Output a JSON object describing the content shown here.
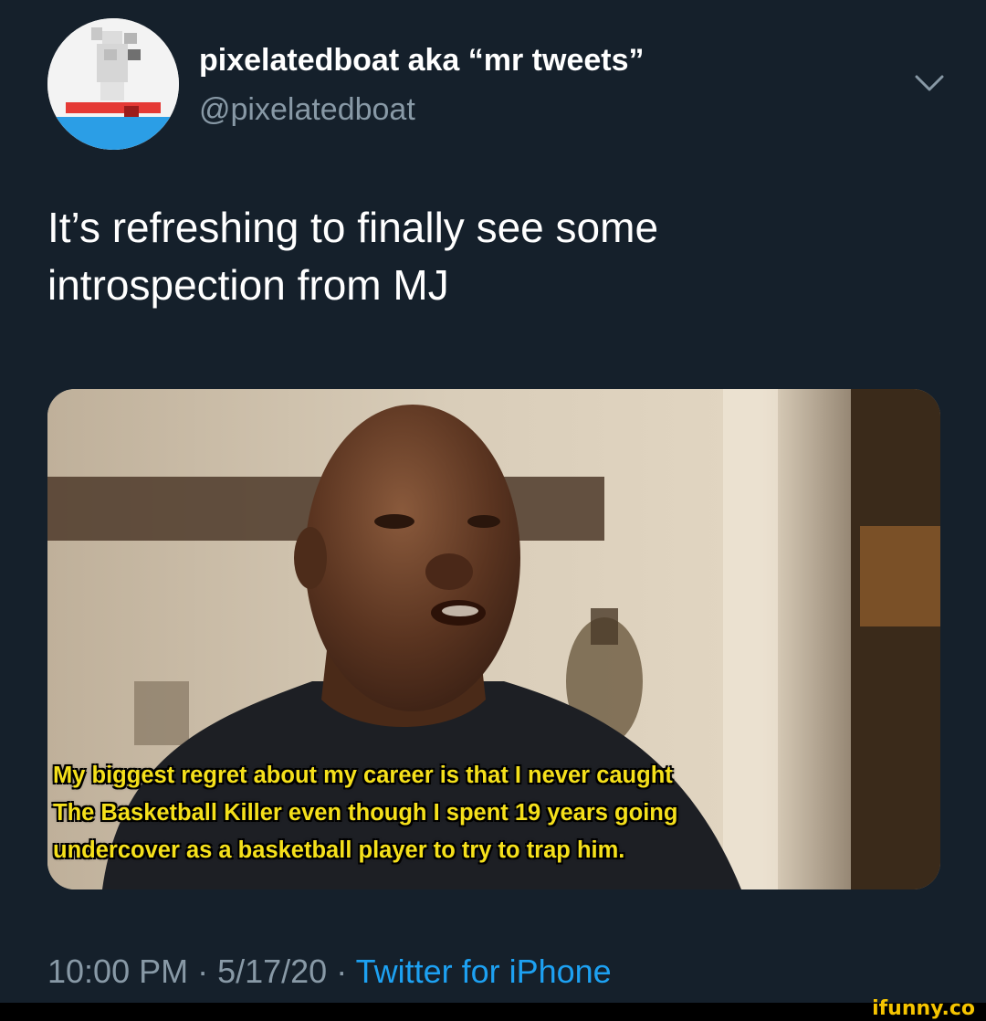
{
  "tweet": {
    "display_name": "pixelatedboat aka “mr tweets”",
    "handle": "@pixelatedboat",
    "text_lines": [
      "It’s refreshing to finally see some",
      "introspection from MJ"
    ],
    "media": {
      "caption_lines": [
        "My biggest regret about my career is that I never caught",
        "The Basketball Killer even though I spent 19 years going",
        "undercover as a basketball player to try to trap him."
      ]
    },
    "time": "10:00 PM",
    "date": "5/17/20",
    "separator": " · ",
    "source": "Twitter for iPhone"
  },
  "watermark": "ifunny.co",
  "colors": {
    "background": "#15202b",
    "secondary_text": "#8899a6",
    "link": "#1da1f2",
    "caption": "#f5e01b"
  }
}
